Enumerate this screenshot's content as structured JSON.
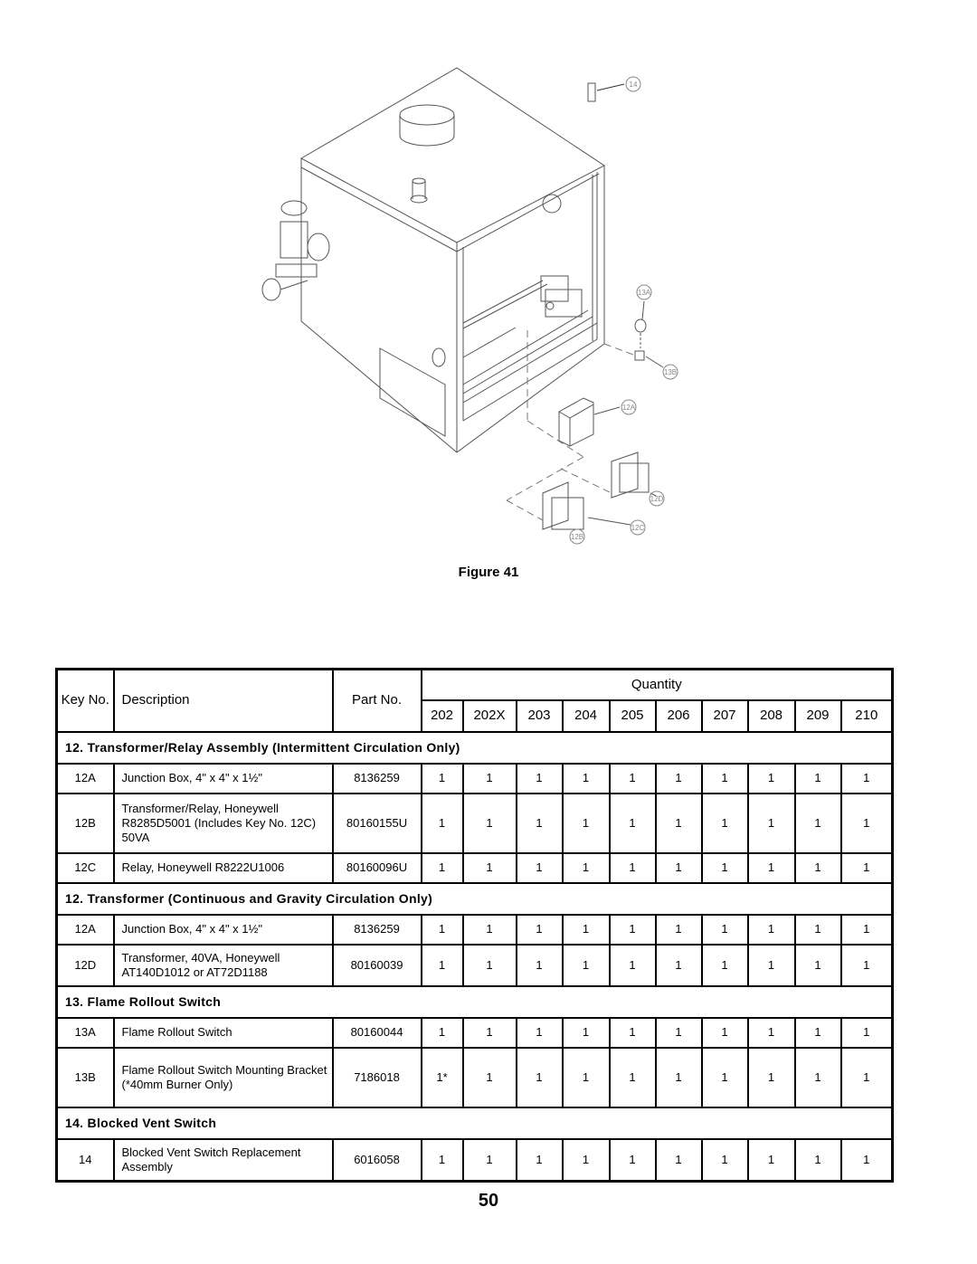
{
  "figure": {
    "caption": "Figure 41",
    "callouts": [
      "14",
      "13A",
      "13B",
      "12A",
      "12D",
      "12C",
      "12B"
    ]
  },
  "table": {
    "headers": {
      "key_no": "Key No.",
      "description": "Description",
      "part_no": "Part No.",
      "quantity": "Quantity",
      "models": [
        "202",
        "202X",
        "203",
        "204",
        "205",
        "206",
        "207",
        "208",
        "209",
        "210"
      ]
    },
    "sections": [
      {
        "title": "12. Transformer/Relay Assembly (Intermittent Circulation Only)",
        "rows": [
          {
            "key": "12A",
            "description": "Junction Box, 4\" x 4\" x 1½\"",
            "part_no": "8136259",
            "qty": [
              "1",
              "1",
              "1",
              "1",
              "1",
              "1",
              "1",
              "1",
              "1",
              "1"
            ]
          },
          {
            "key": "12B",
            "description": "Transformer/Relay, Honeywell R8285D5001 (Includes Key No. 12C) 50VA",
            "part_no": "80160155U",
            "qty": [
              "1",
              "1",
              "1",
              "1",
              "1",
              "1",
              "1",
              "1",
              "1",
              "1"
            ]
          },
          {
            "key": "12C",
            "description": "Relay, Honeywell R8222U1006",
            "part_no": "80160096U",
            "qty": [
              "1",
              "1",
              "1",
              "1",
              "1",
              "1",
              "1",
              "1",
              "1",
              "1"
            ]
          }
        ]
      },
      {
        "title": "12.  Transformer (Continuous and Gravity Circulation Only)",
        "rows": [
          {
            "key": "12A",
            "description": "Junction Box, 4\" x 4\" x 1½\"",
            "part_no": "8136259",
            "qty": [
              "1",
              "1",
              "1",
              "1",
              "1",
              "1",
              "1",
              "1",
              "1",
              "1"
            ]
          },
          {
            "key": "12D",
            "description": "Transformer, 40VA, Honeywell AT140D1012 or AT72D1188",
            "part_no": "80160039",
            "qty": [
              "1",
              "1",
              "1",
              "1",
              "1",
              "1",
              "1",
              "1",
              "1",
              "1"
            ]
          }
        ]
      },
      {
        "title": "13.  Flame Rollout Switch",
        "rows": [
          {
            "key": "13A",
            "description": "Flame Rollout Switch",
            "part_no": "80160044",
            "qty": [
              "1",
              "1",
              "1",
              "1",
              "1",
              "1",
              "1",
              "1",
              "1",
              "1"
            ]
          },
          {
            "key": "13B",
            "description": "Flame Rollout Switch Mounting Bracket (*40mm Burner Only)",
            "part_no": "7186018",
            "qty": [
              "1*",
              "1",
              "1",
              "1",
              "1",
              "1",
              "1",
              "1",
              "1",
              "1"
            ]
          }
        ]
      },
      {
        "title": "14. Blocked Vent Switch",
        "rows": [
          {
            "key": "14",
            "description": "Blocked Vent Switch Replacement Assembly",
            "part_no": "6016058",
            "qty": [
              "1",
              "1",
              "1",
              "1",
              "1",
              "1",
              "1",
              "1",
              "1",
              "1"
            ]
          }
        ]
      }
    ]
  },
  "page_number": "50"
}
